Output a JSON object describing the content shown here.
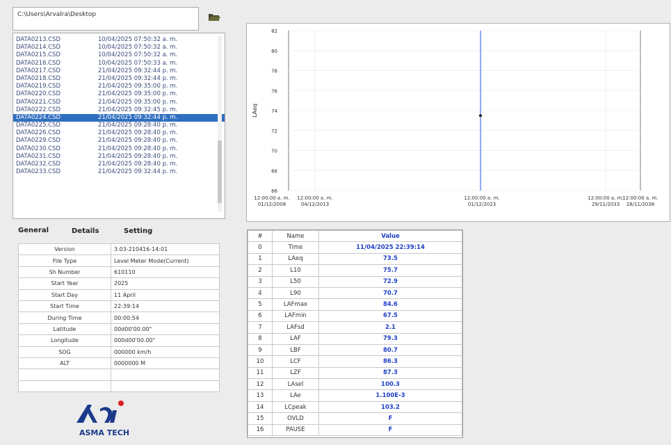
{
  "path": "C:\\Users\\Arvalra\\Desktop",
  "files": [
    {
      "name": "DATA0213.CSD",
      "date": "10/04/2025 07:50:32 a. m."
    },
    {
      "name": "DATA0214.CSD",
      "date": "10/04/2025 07:50:32 a. m."
    },
    {
      "name": "DATA0215.CSD",
      "date": "10/04/2025 07:50:32 a. m."
    },
    {
      "name": "DATA0216.CSD",
      "date": "10/04/2025 07:50:33 a. m."
    },
    {
      "name": "DATA0217.CSD",
      "date": "21/04/2025 09:32:44 p. m."
    },
    {
      "name": "DATA0218.CSD",
      "date": "21/04/2025 09:32:44 p. m."
    },
    {
      "name": "DATA0219.CSD",
      "date": "21/04/2025 09:35:00 p. m."
    },
    {
      "name": "DATA0220.CSD",
      "date": "21/04/2025 09:35:00 p. m."
    },
    {
      "name": "DATA0221.CSD",
      "date": "21/04/2025 09:35:00 p. m."
    },
    {
      "name": "DATA0222.CSD",
      "date": "21/04/2025 09:32:45 p. m."
    },
    {
      "name": "DATA0224.CSD",
      "date": "21/04/2025 09:32:44 p. m.",
      "selected": true
    },
    {
      "name": "DATA0225.CSD",
      "date": "21/04/2025 09:28:40 p. m."
    },
    {
      "name": "DATA0226.CSD",
      "date": "21/04/2025 09:28:40 p. m."
    },
    {
      "name": "DATA0229.CSD",
      "date": "21/04/2025 09:28:40 p. m."
    },
    {
      "name": "DATA0230.CSD",
      "date": "21/04/2025 09:28:40 p. m."
    },
    {
      "name": "DATA0231.CSD",
      "date": "21/04/2025 09:28:40 p. m."
    },
    {
      "name": "DATA0232.CSD",
      "date": "21/04/2025 09:28:40 p. m."
    },
    {
      "name": "DATA0233.CSD",
      "date": "21/04/2025 09:32:44 p. m."
    }
  ],
  "tabs": {
    "general": "General",
    "details": "Details",
    "setting": "Setting"
  },
  "info": [
    {
      "k": "Version",
      "v": "3.03-210416-14:01"
    },
    {
      "k": "File Type",
      "v": "Level Meter Mode(Current)"
    },
    {
      "k": "Sh Number",
      "v": "610110"
    },
    {
      "k": "Start Year",
      "v": "2025"
    },
    {
      "k": "Start Day",
      "v": "11 April"
    },
    {
      "k": "Start Time",
      "v": "22:39:14"
    },
    {
      "k": "During Time",
      "v": "00:00:54"
    },
    {
      "k": "Latitude",
      "v": "00d00'00.00\""
    },
    {
      "k": "Longitude",
      "v": "000d00'00.00\""
    },
    {
      "k": "SOG",
      "v": "000000 km/h"
    },
    {
      "k": "ALT",
      "v": "0000000 M"
    },
    {
      "k": "",
      "v": ""
    },
    {
      "k": "",
      "v": ""
    }
  ],
  "logo": {
    "text": "ASMA TECH",
    "accent": "#e02020",
    "brand": "#1c3a8a"
  },
  "chart_data": {
    "type": "line",
    "ylabel": "LAeq",
    "ylim": [
      66,
      82
    ],
    "yticks": [
      "82",
      "80",
      "78",
      "76",
      "74",
      "72",
      "70",
      "68",
      "66"
    ],
    "xticks": [
      {
        "l1": "12:00:00 a. m.",
        "l2": "01/12/2008"
      },
      {
        "l1": "12:00:00 a. m.",
        "l2": "04/12/2013"
      },
      {
        "l1": "12:00:00 a. m.",
        "l2": "01/12/2023"
      },
      {
        "l1": "12:00:00 a. m.",
        "l2": "29/11/2033"
      },
      {
        "l1": "12:00:00 a. m.",
        "l2": "28/11/2038"
      }
    ],
    "series": [
      {
        "points": [
          {
            "x": "11/04/2025 22:39:14",
            "y": 73.5
          }
        ]
      }
    ],
    "grid": true,
    "line_color": "#2255dd"
  },
  "table": {
    "headers": {
      "idx": "#",
      "name": "Name",
      "value": "Value"
    },
    "rows": [
      {
        "i": "0",
        "n": "Time",
        "v": "11/04/2025 22:39:14"
      },
      {
        "i": "1",
        "n": "LAeq",
        "v": "73.5"
      },
      {
        "i": "2",
        "n": "L10",
        "v": "75.7"
      },
      {
        "i": "3",
        "n": "L50",
        "v": "72.9"
      },
      {
        "i": "4",
        "n": "L90",
        "v": "70.7"
      },
      {
        "i": "5",
        "n": "LAFmax",
        "v": "84.6"
      },
      {
        "i": "6",
        "n": "LAFmin",
        "v": "67.5"
      },
      {
        "i": "7",
        "n": "LAFsd",
        "v": "2.1"
      },
      {
        "i": "8",
        "n": "LAF",
        "v": "79.3"
      },
      {
        "i": "9",
        "n": "LBF",
        "v": "80.7"
      },
      {
        "i": "10",
        "n": "LCF",
        "v": "86.3"
      },
      {
        "i": "11",
        "n": "LZF",
        "v": "87.3"
      },
      {
        "i": "12",
        "n": "LAsel",
        "v": "100.3"
      },
      {
        "i": "13",
        "n": "LAe",
        "v": "1.100E-3"
      },
      {
        "i": "14",
        "n": "LCpeak",
        "v": "103.2"
      },
      {
        "i": "15",
        "n": "OVLD",
        "v": "F"
      },
      {
        "i": "16",
        "n": "PAUSE",
        "v": "F"
      }
    ]
  }
}
